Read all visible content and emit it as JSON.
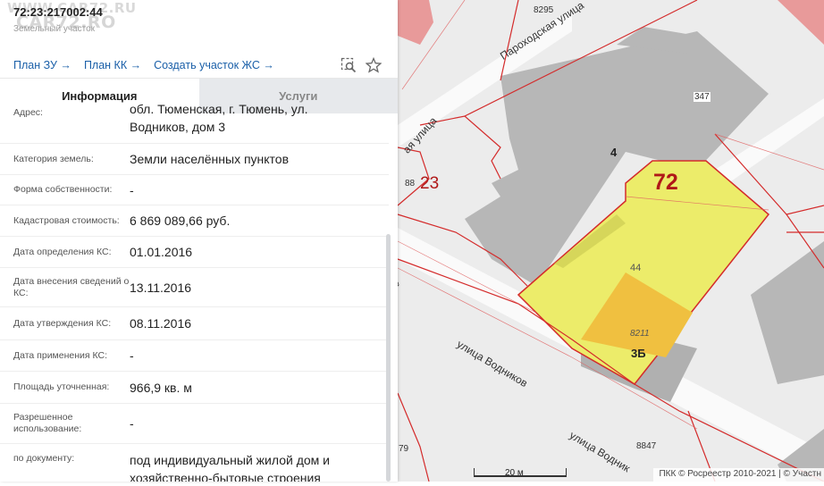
{
  "watermark": {
    "line1": "WWW.CAR72.RU",
    "line2": "CAR72.RO"
  },
  "header": {
    "parcel_id": "72:23:217002:44",
    "parcel_type": "Земельный участок"
  },
  "links": {
    "plan_zu": "План ЗУ →",
    "plan_kk": "План КК →",
    "create_parcel": "Создать участок ЖС →"
  },
  "tabs": {
    "info": "Информация",
    "services": "Услуги"
  },
  "rows": {
    "address": {
      "label": "Адрес:",
      "value_l1": "обл. Тюменская, г. Тюмень, ул.",
      "value_l2": "Водников, дом 3"
    },
    "land_category": {
      "label": "Категория земель:",
      "value": "Земли населённых пунктов"
    },
    "ownership": {
      "label": "Форма собственности:",
      "value": "-"
    },
    "cadastral_value": {
      "label": "Кадастровая стоимость:",
      "value": "6 869 089,66 руб."
    },
    "ks_date": {
      "label": "Дата определения КС:",
      "value": "01.01.2016"
    },
    "ks_entry_date": {
      "label_l1": "Дата внесения сведений о",
      "label_l2": "КС:",
      "value": "13.11.2016"
    },
    "ks_approve_date": {
      "label": "Дата утверждения КС:",
      "value": "08.11.2016"
    },
    "ks_apply_date": {
      "label": "Дата применения КС:",
      "value": "-"
    },
    "area": {
      "label": "Площадь уточненная:",
      "value": "966,9 кв. м"
    },
    "permitted_use": {
      "label_l1": "Разрешенное",
      "label_l2": "использование:",
      "value": "-"
    },
    "by_document": {
      "label": "по документу:",
      "value_l1": "под индивидуальный жилой дом и",
      "value_l2": "хозяйственно-бытовые строения"
    }
  },
  "map": {
    "streets": {
      "parokhodskaya_1": "Пароходская улица",
      "parokhodskaya_2": "ая улица",
      "vodnikov_1": "улица Водников",
      "vodnikov_2": "улица Водник",
      "cut_1": "ов"
    },
    "numbers": {
      "n8295": "8295",
      "n347": "347",
      "n4": "4",
      "n72": "72",
      "n88": "88",
      "n23": "23",
      "n44": "44",
      "n8211": "8211",
      "n3b": "3Б",
      "n8847": "8847",
      "n79": "79"
    },
    "scale": "20 м",
    "attribution": "ПКК © Росреестр 2010-2021 | © Участн"
  },
  "colors": {
    "link": "#1a5fa8",
    "parcel_fill": "#ecec6a",
    "building_fill": "#f0c040",
    "boundary": "#d42b2b"
  }
}
